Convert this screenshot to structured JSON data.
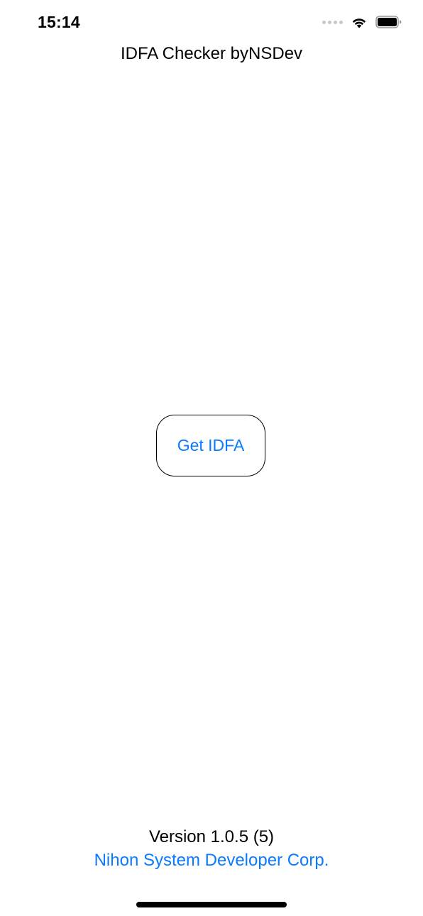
{
  "status_bar": {
    "time": "15:14"
  },
  "header": {
    "title": "IDFA Checker byNSDev"
  },
  "main": {
    "get_idfa_label": "Get IDFA"
  },
  "footer": {
    "version": "Version 1.0.5 (5)",
    "company": "Nihon System Developer Corp."
  },
  "colors": {
    "accent": "#0a7aff",
    "text": "#000000",
    "background": "#ffffff"
  },
  "icons": [
    "cellular-signal-icon",
    "wifi-icon",
    "battery-icon"
  ]
}
